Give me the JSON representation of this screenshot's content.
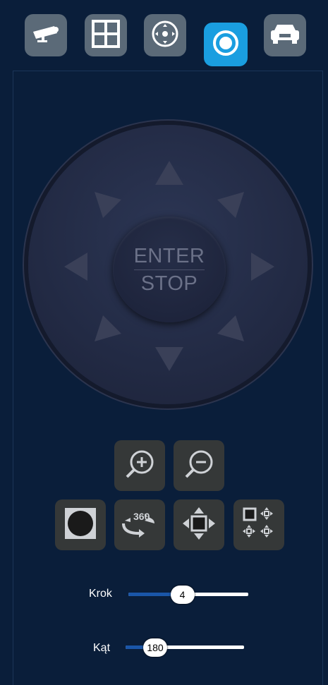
{
  "tabs": [
    {
      "icon": "camera-icon",
      "active": false
    },
    {
      "icon": "grid-icon",
      "active": false
    },
    {
      "icon": "ptz-icon",
      "active": false
    },
    {
      "icon": "record-icon",
      "active": true
    },
    {
      "icon": "car-icon",
      "active": false
    }
  ],
  "joystick": {
    "center_top": "ENTER",
    "center_bottom": "STOP"
  },
  "buttons": {
    "zoom_in": "zoom-in-icon",
    "zoom_out": "zoom-out-icon",
    "preset": "circle-icon",
    "tour_360": "360",
    "pan_move": "move-icon",
    "pattern": "multi-move-icon"
  },
  "sliders": {
    "krok": {
      "label": "Krok",
      "value": "4",
      "fraction": 0.45
    },
    "kat": {
      "label": "Kąt",
      "value": "180",
      "fraction": 0.25
    }
  },
  "colors": {
    "background": "#0a1e3a",
    "active_tab": "#1a9ee0",
    "tab": "#5b6a78",
    "button": "#353838",
    "slider_fill": "#1a56a8"
  }
}
